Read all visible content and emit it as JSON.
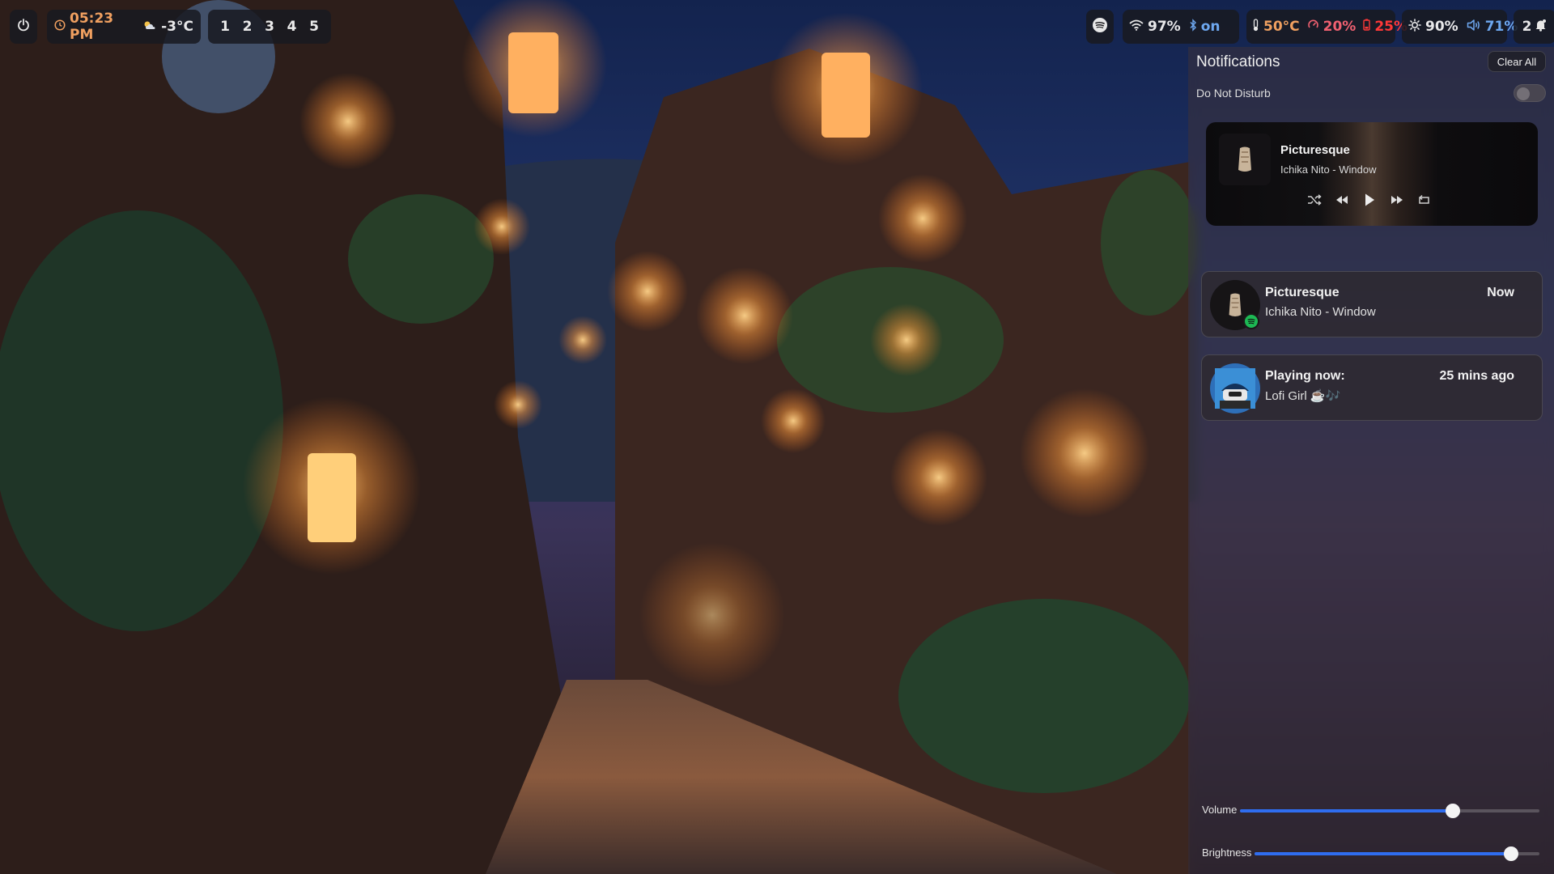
{
  "topbar": {
    "power_icon": "power-icon",
    "clock": {
      "icon": "clock-icon",
      "time": "05:23 PM"
    },
    "weather": {
      "icon": "partly-cloudy-icon",
      "temperature": "-3°C"
    },
    "workspaces": [
      "1",
      "2",
      "3",
      "4",
      "5"
    ],
    "spotify_icon": "spotify-icon",
    "wifi": {
      "icon": "wifi-icon",
      "value": "97%"
    },
    "bluetooth": {
      "icon": "bluetooth-icon",
      "value": "on"
    },
    "temperature": {
      "icon": "thermometer-icon",
      "value": "50°C"
    },
    "cpu": {
      "icon": "cpu-icon",
      "value": "20%"
    },
    "battery": {
      "icon": "battery-icon",
      "value": "25%"
    },
    "brightness": {
      "icon": "brightness-icon",
      "value": "90%"
    },
    "volume": {
      "icon": "speaker-icon",
      "value": "71%"
    },
    "notifications": {
      "icon": "bell-icon",
      "count": "2"
    }
  },
  "panel": {
    "title": "Notifications",
    "clear_label": "Clear All",
    "dnd_label": "Do Not Disturb",
    "dnd_on": false,
    "media": {
      "title": "Picturesque",
      "artist": "Ichika Nito - Window",
      "controls": [
        "shuffle-icon",
        "previous-icon",
        "play-icon",
        "next-icon",
        "repeat-icon"
      ]
    },
    "notifications": [
      {
        "title": "Picturesque",
        "body": "Ichika Nito - Window",
        "time": "Now",
        "badge": "spotify-badge-icon"
      },
      {
        "title": "Playing now:",
        "body": "Lofi Girl ☕🎶",
        "time": "25 mins ago"
      }
    ],
    "sliders": {
      "volume": {
        "label": "Volume",
        "value": 0.71
      },
      "brightness": {
        "label": "Brightness",
        "value": 0.9
      }
    }
  },
  "colors": {
    "accent_blue": "#2f6df0",
    "clock_orange": "#f0a060",
    "cpu_red": "#f06070",
    "battery_red": "#ff3838",
    "bt_blue": "#6ea8f0",
    "spotify_green": "#1db954"
  }
}
